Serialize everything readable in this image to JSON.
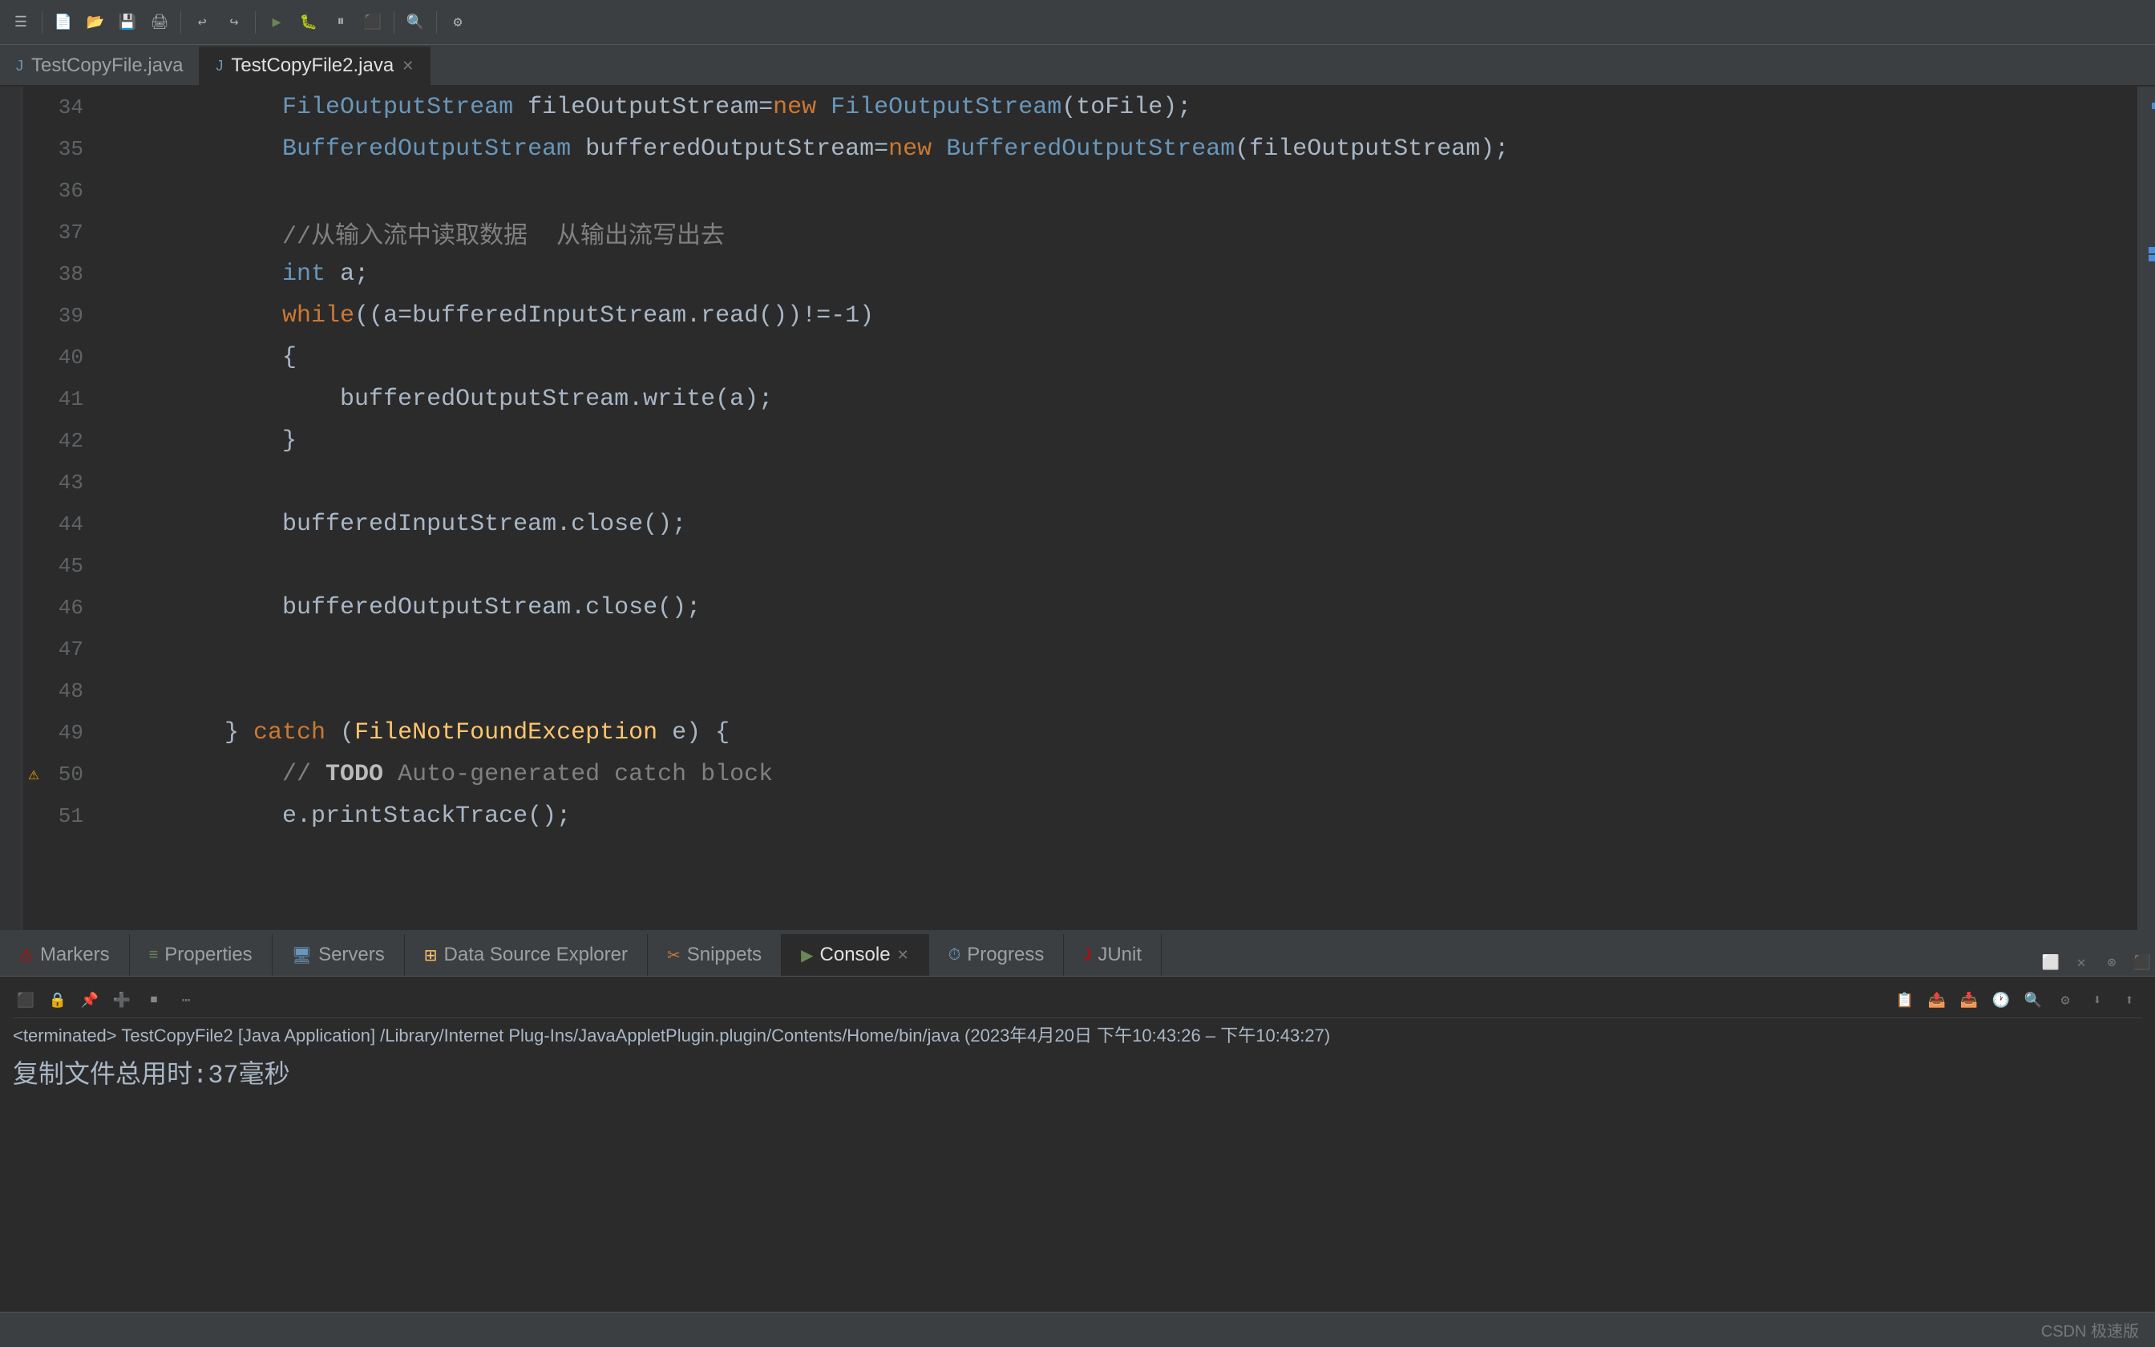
{
  "toolbar": {
    "icons": [
      "≡",
      "◂",
      "▸",
      "⊡",
      "⊞",
      "⊟",
      "❯",
      "⏸",
      "⏹",
      "◉",
      "⏭",
      "⏩",
      "↺",
      "↻",
      "⤵",
      "⤴",
      "↙",
      "↗",
      "🔍",
      "⚙"
    ]
  },
  "tabs": [
    {
      "id": "tab1",
      "label": "TestCopyFile.java",
      "active": false,
      "closable": false
    },
    {
      "id": "tab2",
      "label": "TestCopyFile2.java",
      "active": true,
      "closable": true
    }
  ],
  "code": {
    "lines": [
      {
        "num": "34",
        "tokens": [
          {
            "text": "            FileOutputStream",
            "cls": "kw-blue"
          },
          {
            "text": " fileOutputStream=",
            "cls": "var-white"
          },
          {
            "text": "new",
            "cls": "kw-orange"
          },
          {
            "text": " FileOutputStream",
            "cls": "kw-blue"
          },
          {
            "text": "(toFile);",
            "cls": "var-white"
          }
        ]
      },
      {
        "num": "35",
        "tokens": [
          {
            "text": "            BufferedOutputStream",
            "cls": "kw-blue"
          },
          {
            "text": " bufferedOutputStream=",
            "cls": "var-white"
          },
          {
            "text": "new",
            "cls": "kw-orange"
          },
          {
            "text": " BufferedOutputStream",
            "cls": "kw-blue"
          },
          {
            "text": "(fileOutputStream);",
            "cls": "var-white"
          }
        ]
      },
      {
        "num": "36",
        "tokens": []
      },
      {
        "num": "37",
        "tokens": [
          {
            "text": "            //从输入流中读取数据  从输出流写出去",
            "cls": "comment-gray"
          }
        ]
      },
      {
        "num": "38",
        "tokens": [
          {
            "text": "            ",
            "cls": "var-white"
          },
          {
            "text": "int",
            "cls": "kw-blue"
          },
          {
            "text": " a;",
            "cls": "var-white"
          }
        ]
      },
      {
        "num": "39",
        "tokens": [
          {
            "text": "            ",
            "cls": "var-white"
          },
          {
            "text": "while",
            "cls": "kw-orange"
          },
          {
            "text": "((a=bufferedInputStream.read())!=-1)",
            "cls": "var-white"
          }
        ]
      },
      {
        "num": "40",
        "tokens": [
          {
            "text": "            {",
            "cls": "var-white"
          }
        ]
      },
      {
        "num": "41",
        "tokens": [
          {
            "text": "                bufferedOutputStream.write(a);",
            "cls": "var-white"
          }
        ]
      },
      {
        "num": "42",
        "tokens": [
          {
            "text": "            }",
            "cls": "var-white"
          }
        ]
      },
      {
        "num": "43",
        "tokens": []
      },
      {
        "num": "44",
        "tokens": [
          {
            "text": "            bufferedInputStream.close();",
            "cls": "var-white"
          }
        ]
      },
      {
        "num": "45",
        "tokens": []
      },
      {
        "num": "46",
        "tokens": [
          {
            "text": "            bufferedOutputStream.close();",
            "cls": "var-white"
          }
        ]
      },
      {
        "num": "47",
        "tokens": []
      },
      {
        "num": "48",
        "tokens": []
      },
      {
        "num": "49",
        "tokens": [
          {
            "text": "        } ",
            "cls": "var-white"
          },
          {
            "text": "catch",
            "cls": "kw-orange"
          },
          {
            "text": " (",
            "cls": "var-white"
          },
          {
            "text": "FileNotFoundException",
            "cls": "class-yellow"
          },
          {
            "text": " e) {",
            "cls": "var-white"
          }
        ]
      },
      {
        "num": "50",
        "tokens": [
          {
            "text": "            // ",
            "cls": "comment-gray"
          },
          {
            "text": "TODO",
            "cls": "todo-bold"
          },
          {
            "text": " Auto-generated catch block",
            "cls": "comment-gray"
          }
        ]
      },
      {
        "num": "51",
        "tokens": [
          {
            "text": "            e.printStackTrace();",
            "cls": "var-white"
          }
        ]
      }
    ]
  },
  "bottom_tabs": [
    {
      "id": "markers",
      "label": "Markers",
      "active": false,
      "closable": false
    },
    {
      "id": "properties",
      "label": "Properties",
      "active": false,
      "closable": false
    },
    {
      "id": "servers",
      "label": "Servers",
      "active": false,
      "closable": false
    },
    {
      "id": "datasource",
      "label": "Data Source Explorer",
      "active": false,
      "closable": false
    },
    {
      "id": "snippets",
      "label": "Snippets",
      "active": false,
      "closable": false
    },
    {
      "id": "console",
      "label": "Console",
      "active": true,
      "closable": true
    },
    {
      "id": "progress",
      "label": "Progress",
      "active": false,
      "closable": false
    },
    {
      "id": "junit",
      "label": "JUnit",
      "active": false,
      "closable": false
    }
  ],
  "console": {
    "terminated_line": "<terminated> TestCopyFile2 [Java Application] /Library/Internet Plug-Ins/JavaAppletPlugin.plugin/Contents/Home/bin/java  (2023年4月20日 下午10:43:26 – 下午10:43:27)",
    "output": "复制文件总用时:37毫秒"
  },
  "status_bar": {
    "right_text": "CSDN 极速版"
  }
}
